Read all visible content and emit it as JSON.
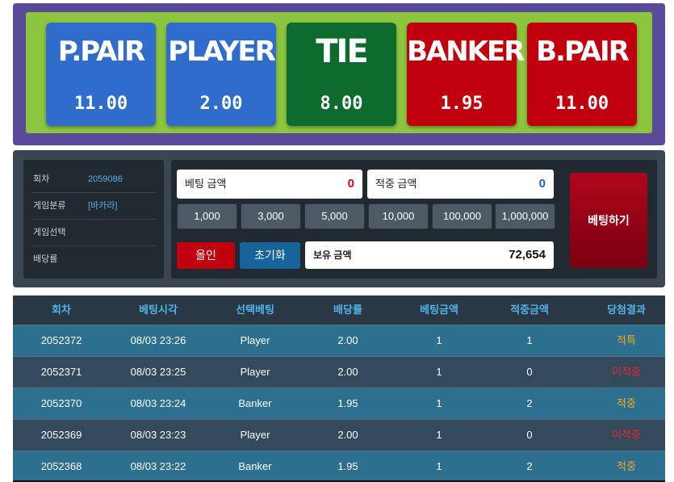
{
  "bets": [
    {
      "name": "P.PAIR",
      "odds": "11.00",
      "color": "#2f6ccc"
    },
    {
      "name": "PLAYER",
      "odds": "2.00",
      "color": "#2f6ccc"
    },
    {
      "name": "TIE",
      "odds": "8.00",
      "color": "#0e6b2e"
    },
    {
      "name": "BANKER",
      "odds": "1.95",
      "color": "#c0000e"
    },
    {
      "name": "B.PAIR",
      "odds": "11.00",
      "color": "#c0000e"
    }
  ],
  "info": {
    "round_label": "회차",
    "round_value": "2059086",
    "category_label": "게임분류",
    "category_value": "[바카라]",
    "selection_label": "게임선택",
    "selection_value": "",
    "odds_label": "배당률",
    "odds_value": ""
  },
  "betting": {
    "bet_amount_label": "베팅 금액",
    "bet_amount_value": "0",
    "win_amount_label": "적중 금액",
    "win_amount_value": "0",
    "chips": [
      "1,000",
      "3,000",
      "5,000",
      "10,000",
      "100,000",
      "1,000,000"
    ],
    "allin_label": "올인",
    "reset_label": "초기화",
    "balance_label": "보유 금액",
    "balance_value": "72,654",
    "place_bet_label": "베팅하기"
  },
  "history": {
    "columns": [
      "회차",
      "베팅시각",
      "선택베팅",
      "배당률",
      "베팅금액",
      "적중금액",
      "당첨결과"
    ],
    "rows": [
      {
        "round": "2052372",
        "time": "08/03 23:26",
        "pick": "Player",
        "odds": "2.00",
        "bet": "1",
        "win": "1",
        "result": "적특",
        "result_color": "#f5a623"
      },
      {
        "round": "2052371",
        "time": "08/03 23:25",
        "pick": "Player",
        "odds": "2.00",
        "bet": "1",
        "win": "0",
        "result": "미적중",
        "result_color": "#e8262d"
      },
      {
        "round": "2052370",
        "time": "08/03 23:24",
        "pick": "Banker",
        "odds": "1.95",
        "bet": "1",
        "win": "2",
        "result": "적중",
        "result_color": "#f5a623"
      },
      {
        "round": "2052369",
        "time": "08/03 23:23",
        "pick": "Player",
        "odds": "2.00",
        "bet": "1",
        "win": "0",
        "result": "미적중",
        "result_color": "#e8262d"
      },
      {
        "round": "2052368",
        "time": "08/03 23:22",
        "pick": "Banker",
        "odds": "1.95",
        "bet": "1",
        "win": "2",
        "result": "적중",
        "result_color": "#f5a623"
      }
    ],
    "row_colors": [
      "#2d6f8e",
      "#33495c"
    ]
  }
}
